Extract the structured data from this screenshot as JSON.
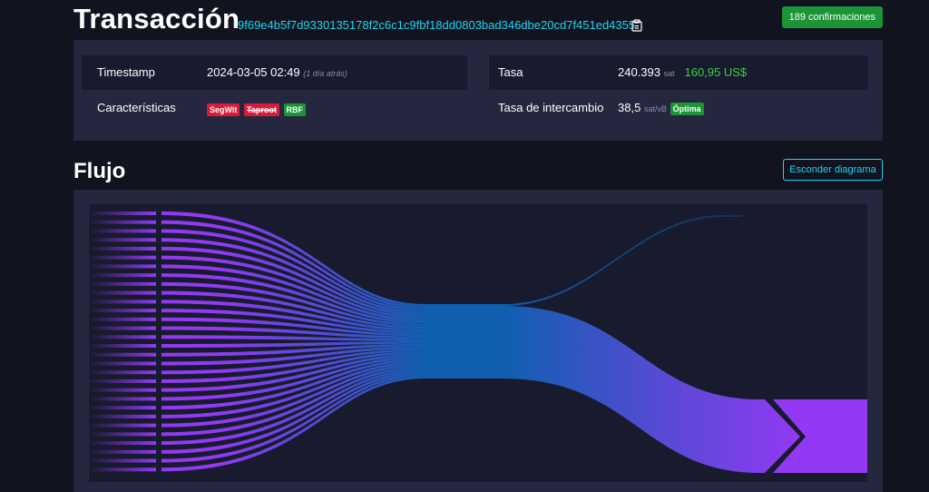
{
  "header": {
    "title": "Transacción",
    "txid": "9f69e4b5f7d9330135178f2c6c1c9fbf18dd0803bad346dbe20cd7f451ed4355",
    "confirmations": "189 confirmaciones"
  },
  "details": {
    "timestamp_label": "Timestamp",
    "timestamp_value": "2024-03-05 02:49",
    "timestamp_ago": "(1 día atrás)",
    "features_label": "Características",
    "features": [
      "SegWit",
      "Taproot",
      "RBF"
    ],
    "fee_label": "Tasa",
    "fee_value": "240.393",
    "fee_unit": "sat",
    "fee_usd": "160,95 US$",
    "rate_label": "Tasa de intercambio",
    "rate_value": "38,5",
    "rate_unit": "sat/vB",
    "rate_badge": "Óptima"
  },
  "flow": {
    "title": "Flujo",
    "toggle_label": "Esconder diagrama"
  },
  "colors": {
    "accent": "#1bd8f4",
    "success": "#1a9436",
    "danger": "#d81b3c",
    "input_purple": "#9339f4",
    "output_blue": "#105fb0"
  },
  "icons": {
    "copy": "clipboard-icon"
  }
}
